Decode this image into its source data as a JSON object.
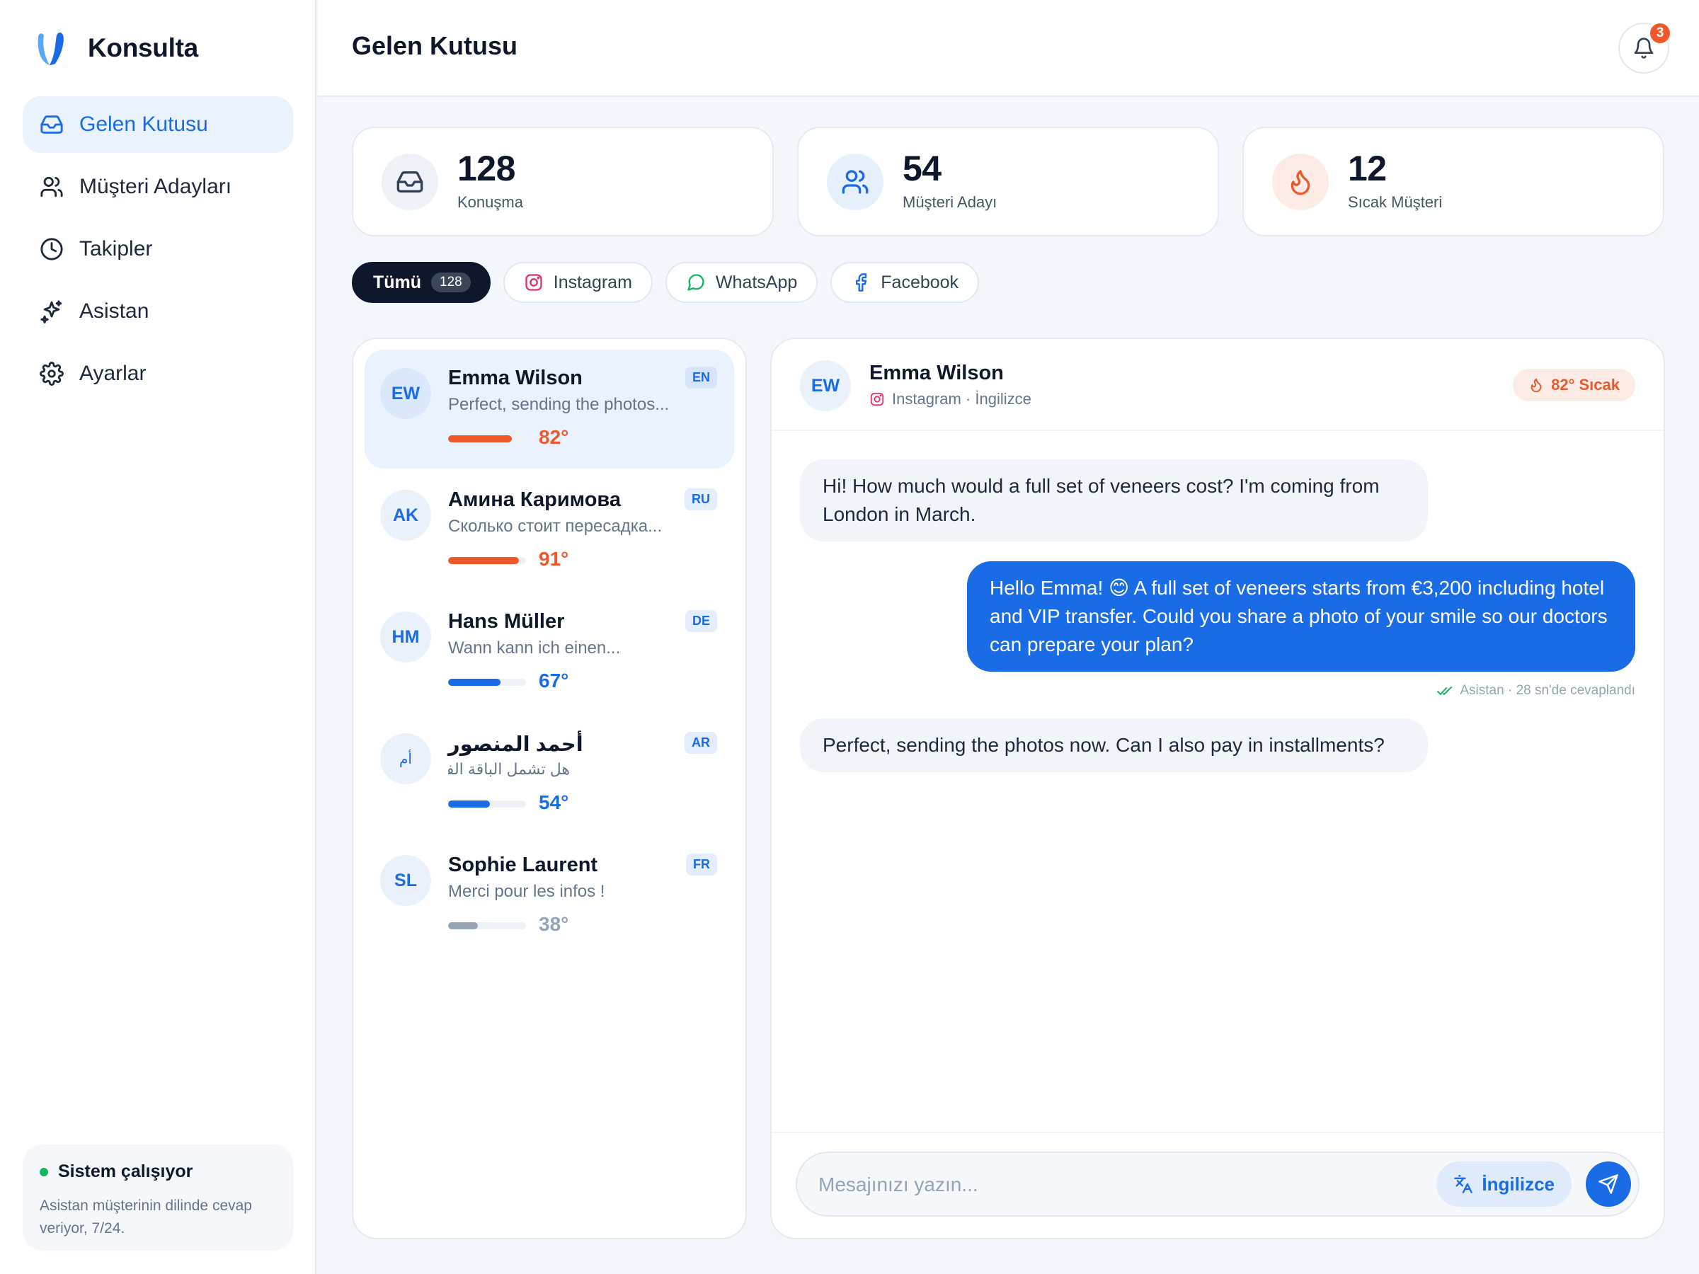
{
  "app": {
    "name": "Konsulta"
  },
  "sidebar": {
    "items": [
      {
        "label": "Gelen Kutusu",
        "icon": "inbox-icon",
        "active": true
      },
      {
        "label": "Müşteri Adayları",
        "icon": "users-icon",
        "active": false
      },
      {
        "label": "Takipler",
        "icon": "clock-icon",
        "active": false
      },
      {
        "label": "Asistan",
        "icon": "sparkles-icon",
        "active": false
      },
      {
        "label": "Ayarlar",
        "icon": "gear-icon",
        "active": false
      }
    ],
    "status": {
      "title": "Sistem çalışıyor",
      "description": "Asistan müşterinin dilinde cevap veriyor, 7/24."
    }
  },
  "header": {
    "title": "Gelen Kutusu",
    "notification_count": "3"
  },
  "stats": [
    {
      "value": "128",
      "label": "Konuşma",
      "icon": "inbox-icon"
    },
    {
      "value": "54",
      "label": "Müşteri Adayı",
      "icon": "users-icon"
    },
    {
      "value": "12",
      "label": "Sıcak Müşteri",
      "icon": "flame-icon"
    }
  ],
  "filters": [
    {
      "label": "Tümü",
      "count": "128",
      "active": true
    },
    {
      "label": "Instagram",
      "icon": "instagram-icon"
    },
    {
      "label": "WhatsApp",
      "icon": "whatsapp-icon"
    },
    {
      "label": "Facebook",
      "icon": "facebook-icon"
    }
  ],
  "conversations": [
    {
      "initials": "EW",
      "name": "Emma Wilson",
      "preview": "Perfect, sending the photos...",
      "lang": "EN",
      "heat": "82°",
      "heat_pct": 82,
      "color": "#f0582c",
      "selected": true
    },
    {
      "initials": "AK",
      "name": "Амина Каримова",
      "preview": "Сколько стоит пересадка...",
      "lang": "RU",
      "heat": "91°",
      "heat_pct": 91,
      "color": "#f0582c",
      "selected": false
    },
    {
      "initials": "HM",
      "name": "Hans Müller",
      "preview": "Wann kann ich einen...",
      "lang": "DE",
      "heat": "67°",
      "heat_pct": 67,
      "color": "#1a6be6",
      "selected": false
    },
    {
      "initials": "أم",
      "name": "أحمد المنصور",
      "preview": "هل تشمل الباقة الفندق؟",
      "lang": "AR",
      "heat": "54°",
      "heat_pct": 54,
      "color": "#1a6be6",
      "selected": false,
      "rtl": true
    },
    {
      "initials": "SL",
      "name": "Sophie Laurent",
      "preview": "Merci pour les infos !",
      "lang": "FR",
      "heat": "38°",
      "heat_pct": 38,
      "color": "#94a3b8",
      "selected": false
    }
  ],
  "chat": {
    "initials": "EW",
    "name": "Emma Wilson",
    "subtitle": "Instagram · İngilizce",
    "heat_label": "82° Sıcak",
    "messages": [
      {
        "direction": "in",
        "text": "Hi! How much would a full set of veneers cost? I'm coming from London in March."
      },
      {
        "direction": "out",
        "text": "Hello Emma! 😊 A full set of veneers starts from €3,200 including hotel and VIP transfer. Could you share a photo of your smile so our doctors can prepare your plan?"
      },
      {
        "direction": "in",
        "text": "Perfect, sending the photos now. Can I also pay in installments?"
      }
    ],
    "reply_meta": "Asistan · 28 sn'de cevaplandı",
    "composer": {
      "placeholder": "Mesajınızı yazın...",
      "value": "",
      "language_button": "İngilizce"
    }
  },
  "colors": {
    "accent": "#1a6be6",
    "hot": "#f0582c",
    "dark": "#0f172a",
    "success": "#16b35e"
  }
}
